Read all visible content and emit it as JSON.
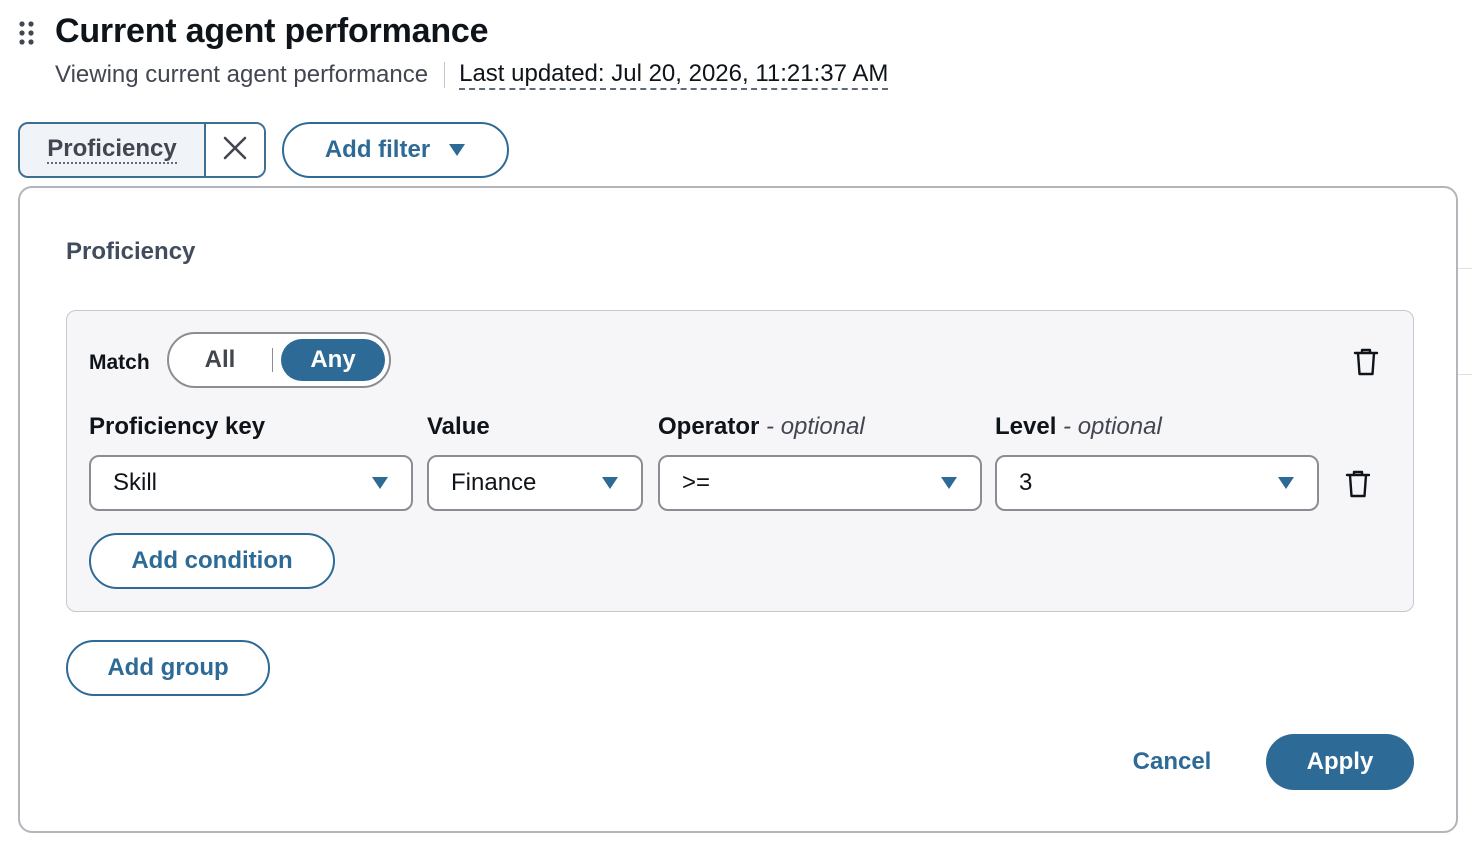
{
  "header": {
    "title": "Current agent performance",
    "subtitle": "Viewing current agent performance",
    "last_updated": "Last updated: Jul 20, 2026, 11:21:37 AM"
  },
  "filters": {
    "active_token": "Proficiency",
    "add_filter_label": "Add filter"
  },
  "popover": {
    "title": "Proficiency",
    "group": {
      "match_label": "Match",
      "match_options": [
        "All",
        "Any"
      ],
      "match_selected": "Any",
      "fields": {
        "proficiency_key": {
          "label": "Proficiency key",
          "value": "Skill"
        },
        "value": {
          "label": "Value",
          "value": "Finance"
        },
        "operator": {
          "label": "Operator",
          "optional": "- optional",
          "value": ">="
        },
        "level": {
          "label": "Level",
          "optional": "- optional",
          "value": "3"
        }
      },
      "add_condition_label": "Add condition"
    },
    "add_group_label": "Add group",
    "cancel_label": "Cancel",
    "apply_label": "Apply"
  },
  "colors": {
    "accent": "#2d6a96",
    "token_border": "#3e6f91",
    "group_background": "#f6f6f9",
    "panel_border": "#b4b4bb"
  },
  "icons": {
    "drag": "drag-handle-icon",
    "remove": "close-icon",
    "dropdown": "caret-down-icon",
    "delete": "trash-icon"
  }
}
